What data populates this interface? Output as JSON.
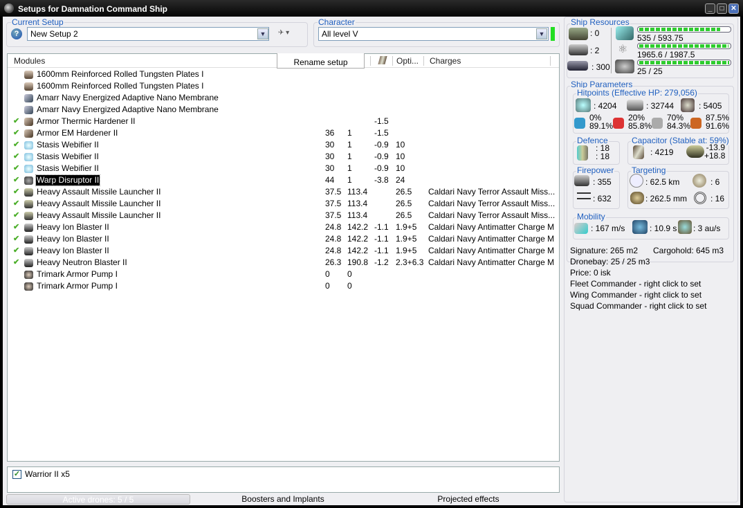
{
  "window": {
    "title": "Setups for Damnation Command Ship",
    "minimize": "_",
    "maximize": "□",
    "close": "✕"
  },
  "current_setup": {
    "label": "Current Setup",
    "value": "New Setup 2",
    "help_icon": "?"
  },
  "character": {
    "label": "Character",
    "value": "All level V",
    "status_color": "#22dd22"
  },
  "tooltip": "Rename setup",
  "columns": {
    "modules": "Modules",
    "optimal": "Opti...",
    "charges": "Charges"
  },
  "modules": [
    {
      "name": "1600mm Reinforced Rolled Tungsten Plates I",
      "active": false,
      "icon": "armor-plate-icon",
      "cpu": "",
      "pg": "",
      "cap": "",
      "opt": "",
      "charge": ""
    },
    {
      "name": "1600mm Reinforced Rolled Tungsten Plates I",
      "active": false,
      "icon": "armor-plate-icon",
      "cpu": "",
      "pg": "",
      "cap": "",
      "opt": "",
      "charge": ""
    },
    {
      "name": "Amarr Navy Energized Adaptive Nano Membrane",
      "active": false,
      "icon": "membrane-icon",
      "cpu": "",
      "pg": "",
      "cap": "",
      "opt": "",
      "charge": ""
    },
    {
      "name": "Amarr Navy Energized Adaptive Nano Membrane",
      "active": false,
      "icon": "membrane-icon",
      "cpu": "",
      "pg": "",
      "cap": "",
      "opt": "",
      "charge": ""
    },
    {
      "name": "Armor Thermic Hardener II",
      "active": true,
      "icon": "hardener-icon",
      "cpu": "",
      "pg": "",
      "cap": "-1.5",
      "opt": "",
      "charge": ""
    },
    {
      "name": "Armor EM Hardener II",
      "active": true,
      "icon": "hardener-icon",
      "cpu": "36",
      "pg": "1",
      "cap": "-1.5",
      "opt": "",
      "charge": ""
    },
    {
      "name": "Stasis Webifier II",
      "active": true,
      "icon": "webifier-icon",
      "cpu": "30",
      "pg": "1",
      "cap": "-0.9",
      "opt": "10",
      "charge": ""
    },
    {
      "name": "Stasis Webifier II",
      "active": true,
      "icon": "webifier-icon",
      "cpu": "30",
      "pg": "1",
      "cap": "-0.9",
      "opt": "10",
      "charge": ""
    },
    {
      "name": "Stasis Webifier II",
      "active": true,
      "icon": "webifier-icon",
      "cpu": "30",
      "pg": "1",
      "cap": "-0.9",
      "opt": "10",
      "charge": ""
    },
    {
      "name": "Warp Disruptor II",
      "active": true,
      "selected": true,
      "icon": "warp-disruptor-icon",
      "cpu": "44",
      "pg": "1",
      "cap": "-3.8",
      "opt": "24",
      "charge": ""
    },
    {
      "name": "Heavy Assault Missile Launcher II",
      "active": true,
      "icon": "missile-launcher-icon",
      "cpu": "37.5",
      "pg": "113.4",
      "cap": "",
      "opt": "26.5",
      "charge": "Caldari Navy Terror Assault Miss..."
    },
    {
      "name": "Heavy Assault Missile Launcher II",
      "active": true,
      "icon": "missile-launcher-icon",
      "cpu": "37.5",
      "pg": "113.4",
      "cap": "",
      "opt": "26.5",
      "charge": "Caldari Navy Terror Assault Miss..."
    },
    {
      "name": "Heavy Assault Missile Launcher II",
      "active": true,
      "icon": "missile-launcher-icon",
      "cpu": "37.5",
      "pg": "113.4",
      "cap": "",
      "opt": "26.5",
      "charge": "Caldari Navy Terror Assault Miss..."
    },
    {
      "name": "Heavy Ion Blaster II",
      "active": true,
      "icon": "blaster-icon",
      "cpu": "24.8",
      "pg": "142.2",
      "cap": "-1.1",
      "opt": "1.9+5",
      "charge": "Caldari Navy Antimatter Charge M"
    },
    {
      "name": "Heavy Ion Blaster II",
      "active": true,
      "icon": "blaster-icon",
      "cpu": "24.8",
      "pg": "142.2",
      "cap": "-1.1",
      "opt": "1.9+5",
      "charge": "Caldari Navy Antimatter Charge M"
    },
    {
      "name": "Heavy Ion Blaster II",
      "active": true,
      "icon": "blaster-icon",
      "cpu": "24.8",
      "pg": "142.2",
      "cap": "-1.1",
      "opt": "1.9+5",
      "charge": "Caldari Navy Antimatter Charge M"
    },
    {
      "name": "Heavy Neutron Blaster II",
      "active": true,
      "icon": "blaster-icon",
      "cpu": "26.3",
      "pg": "190.8",
      "cap": "-1.2",
      "opt": "2.3+6.3",
      "charge": "Caldari Navy Antimatter Charge M"
    },
    {
      "name": "Trimark Armor Pump I",
      "active": false,
      "icon": "rig-icon",
      "cpu": "0",
      "pg": "0",
      "cap": "",
      "opt": "",
      "charge": ""
    },
    {
      "name": "Trimark Armor Pump I",
      "active": false,
      "icon": "rig-icon",
      "cpu": "0",
      "pg": "0",
      "cap": "",
      "opt": "",
      "charge": ""
    }
  ],
  "drones": [
    {
      "name": "Warrior II x5",
      "checked": true
    }
  ],
  "bottom": {
    "active_drones": "Active drones: 5 / 5",
    "boosters": "Boosters and Implants",
    "projected": "Projected effects"
  },
  "resources": {
    "label": "Ship Resources",
    "turrets": ": 0",
    "launchers": ": 2",
    "calibration": ": 300",
    "cpu": "535 / 593.75",
    "cpu_fill": 0.9,
    "powergrid": "1965.6 / 1987.5",
    "powergrid_fill": 0.99,
    "drone_bw": "25 / 25",
    "drone_bw_fill": 1.0
  },
  "params": {
    "label": "Ship Parameters",
    "hitpoints_label": "Hitpoints (Effective HP: 279,056)",
    "shield": ": 4204",
    "armor": ": 32744",
    "structure": ": 5405",
    "resists": [
      {
        "a": "0%",
        "b": "89.1%"
      },
      {
        "a": "20%",
        "b": "85.8%"
      },
      {
        "a": "70%",
        "b": "84.3%"
      },
      {
        "a": "87.5%",
        "b": "91.6%"
      }
    ],
    "defence_label": "Defence",
    "defence_a": ": 18",
    "defence_b": ": 18",
    "capacitor_label": "Capacitor (Stable at: 59%)",
    "capacitor": ": 4219",
    "cap_use": "-13.9",
    "cap_regen": "+18.8",
    "firepower_label": "Firepower",
    "volley": ": 355",
    "dps": ": 632",
    "targeting_label": "Targeting",
    "range": ": 62.5 km",
    "max_targets": ": 6",
    "scan_res": ": 262.5 mm",
    "sensor": ": 16",
    "mobility_label": "Mobility",
    "speed": ": 167 m/s",
    "align": ": 10.9 s",
    "warp": ": 3 au/s"
  },
  "info": {
    "signature": "Signature: 265 m2",
    "cargo": "Cargohold: 645 m3",
    "dronebay": "Dronebay: 25 / 25 m3",
    "price": "Price: 0 isk",
    "fleet": "Fleet Commander - right click to set",
    "wing": "Wing Commander - right click to set",
    "squad": "Squad Commander - right click to set"
  }
}
